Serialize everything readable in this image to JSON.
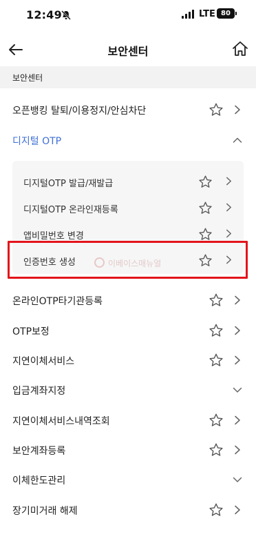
{
  "status_bar": {
    "time": "12:49",
    "network": "LTE",
    "battery": "80"
  },
  "header": {
    "title": "보안센터"
  },
  "section": {
    "title": "보안센터"
  },
  "menu": {
    "open_banking": "오픈뱅킹 탈퇴/이용정지/안심차단",
    "digital_otp": "디지털 OTP",
    "sub": {
      "issue": "디지털OTP 발급/재발급",
      "reregister": "디지털OTP 온라인재등록",
      "app_pin": "앱비밀번호 변경",
      "auth_code": "인증번호 생성"
    },
    "online_otp": "온라인OTP타기관등록",
    "otp_compensation": "OTP보정",
    "delayed_transfer": "지연이체서비스",
    "deposit_account": "입금계좌지정",
    "delayed_history": "지연이체서비스내역조회",
    "security_account": "보안계좌등록",
    "transfer_limit": "이체한도관리",
    "dormant_release": "장기미거래 해제"
  },
  "watermark": "이베이스매뉴얼",
  "colors": {
    "accent": "#3f6fd6",
    "highlight": "#e3141b",
    "section_bg": "#f2f2f2"
  }
}
